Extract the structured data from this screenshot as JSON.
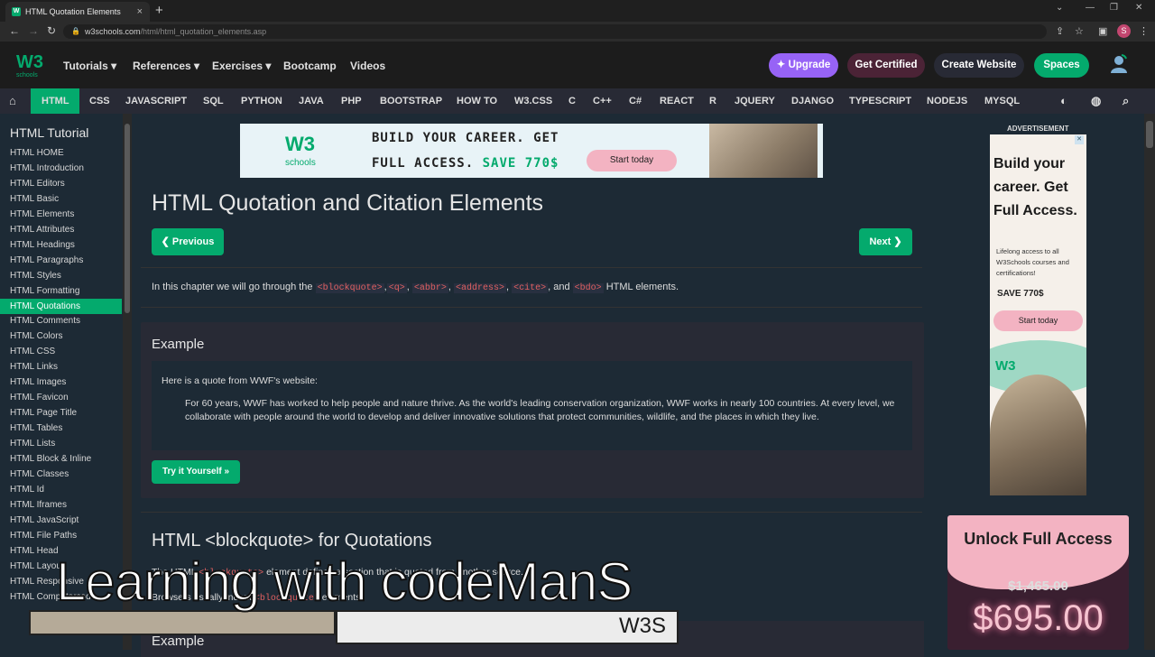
{
  "browser": {
    "tab_title": "HTML Quotation Elements",
    "tab_favicon": "W",
    "close_tab": "×",
    "new_tab": "+",
    "url_host": "w3schools.com",
    "url_path": "/html/html_quotation_elements.asp",
    "profile_initial": "S"
  },
  "header": {
    "logo": "W3",
    "logo_sub": "schools",
    "menu": [
      "Tutorials",
      "References",
      "Exercises",
      "Bootcamp",
      "Videos"
    ],
    "upgrade": "Upgrade",
    "get_certified": "Get Certified",
    "create_website": "Create Website",
    "spaces": "Spaces"
  },
  "subnav": [
    "HTML",
    "CSS",
    "JAVASCRIPT",
    "SQL",
    "PYTHON",
    "JAVA",
    "PHP",
    "BOOTSTRAP",
    "HOW TO",
    "W3.CSS",
    "C",
    "C++",
    "C#",
    "REACT",
    "R",
    "JQUERY",
    "DJANGO",
    "TYPESCRIPT",
    "NODEJS",
    "MYSQL"
  ],
  "sidebar": {
    "title": "HTML Tutorial",
    "items": [
      "HTML HOME",
      "HTML Introduction",
      "HTML Editors",
      "HTML Basic",
      "HTML Elements",
      "HTML Attributes",
      "HTML Headings",
      "HTML Paragraphs",
      "HTML Styles",
      "HTML Formatting",
      "HTML Quotations",
      "HTML Comments",
      "HTML Colors",
      "HTML CSS",
      "HTML Links",
      "HTML Images",
      "HTML Favicon",
      "HTML Page Title",
      "HTML Tables",
      "HTML Lists",
      "HTML Block & Inline",
      "HTML Classes",
      "HTML Id",
      "HTML Iframes",
      "HTML JavaScript",
      "HTML File Paths",
      "HTML Head",
      "HTML Layout",
      "HTML Responsive",
      "HTML Computercode"
    ],
    "active_index": 10
  },
  "ad_banner": {
    "logo": "W3",
    "logo_sub": "schools",
    "line1": "BUILD YOUR CAREER. GET",
    "line2a": "FULL ACCESS.",
    "line2b": "SAVE 770$",
    "button": "Start today"
  },
  "main": {
    "title": "HTML Quotation and Citation Elements",
    "prev": "❮ Previous",
    "next": "Next ❯",
    "intro_prefix": "In this chapter we will go through the",
    "intro_tags": [
      "<blockquote>",
      "<q>",
      "<abbr>",
      "<address>",
      "<cite>",
      "<bdo>"
    ],
    "intro_sep": [
      ",",
      ",",
      ",",
      ",",
      ", and"
    ],
    "intro_suffix": "HTML elements.",
    "example_title": "Example",
    "example_line1": "Here is a quote from WWF's website:",
    "example_quote": "For 60 years, WWF has worked to help people and nature thrive. As the world's leading conservation organization, WWF works in nearly 100 countries. At every level, we collaborate with people around the world to develop and deliver innovative solutions that protect communities, wildlife, and the places in which they live.",
    "try_button": "Try it Yourself »",
    "section_title": "HTML <blockquote> for Quotations",
    "section_p1a": "The HTML",
    "section_p1_tag": "<blockquote>",
    "section_p1b": "element defines a section that is quoted from another source.",
    "section_p2a": "Browsers usually indent",
    "section_p2_tag": "<blockquote>",
    "section_p2b": "elements.",
    "example2_title": "Example"
  },
  "right": {
    "advertisement": "ADVERTISEMENT",
    "sky_headline": "Build your career. Get Full Access.",
    "sky_text": "Lifelong access to all W3Schools courses and certifications!",
    "sky_save": "SAVE 770$",
    "sky_button": "Start today",
    "sky_logo": "W3",
    "unlock_title": "Unlock Full Access",
    "old_price": "$1,465.00",
    "new_price": "$695.00"
  },
  "caption": {
    "text": "Learning with codeManS",
    "tag": "W3S"
  },
  "colors": {
    "accent": "#04aa6d",
    "upgrade": "#9763f6",
    "certified": "#4b2336",
    "create": "#282a35"
  }
}
